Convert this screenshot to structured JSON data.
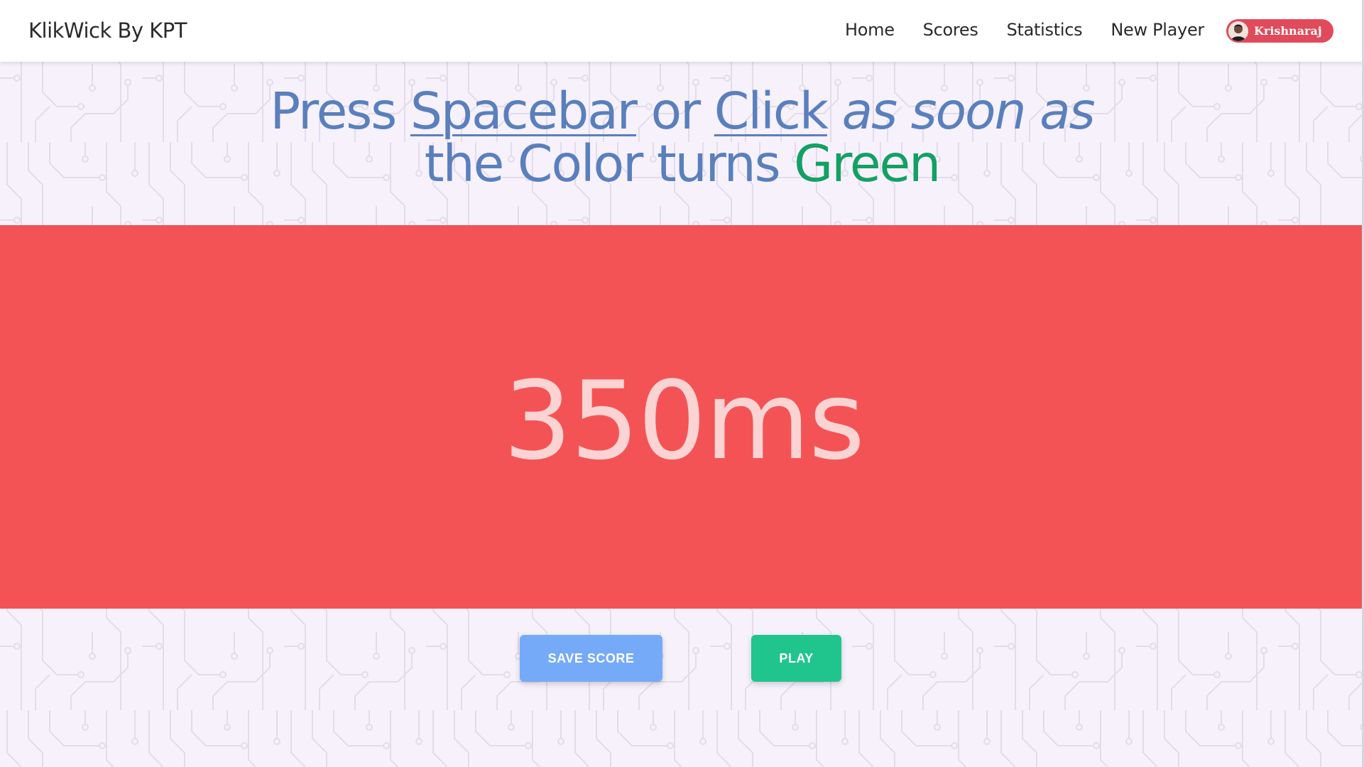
{
  "app": {
    "brand": "KlikWick By KPT"
  },
  "nav": {
    "items": [
      "Home",
      "Scores",
      "Statistics",
      "New Player"
    ]
  },
  "user": {
    "name": "Krishnaraj"
  },
  "headline": {
    "press": "Press",
    "spacebar": "Spacebar",
    "or": "or",
    "click": "Click",
    "as_soon_as": "as soon as",
    "the_color_turns": "the Color turns",
    "green": "Green"
  },
  "game": {
    "reaction_time": "350ms",
    "panel_color": "#f45356"
  },
  "actions": {
    "save_label": "SAVE SCORE",
    "play_label": "PLAY"
  },
  "colors": {
    "headline": "#5a7fbd",
    "accent_green": "#14a064",
    "save_button": "#75aaf8",
    "play_button": "#1fc58c",
    "user_chip": "#e04a5a"
  }
}
